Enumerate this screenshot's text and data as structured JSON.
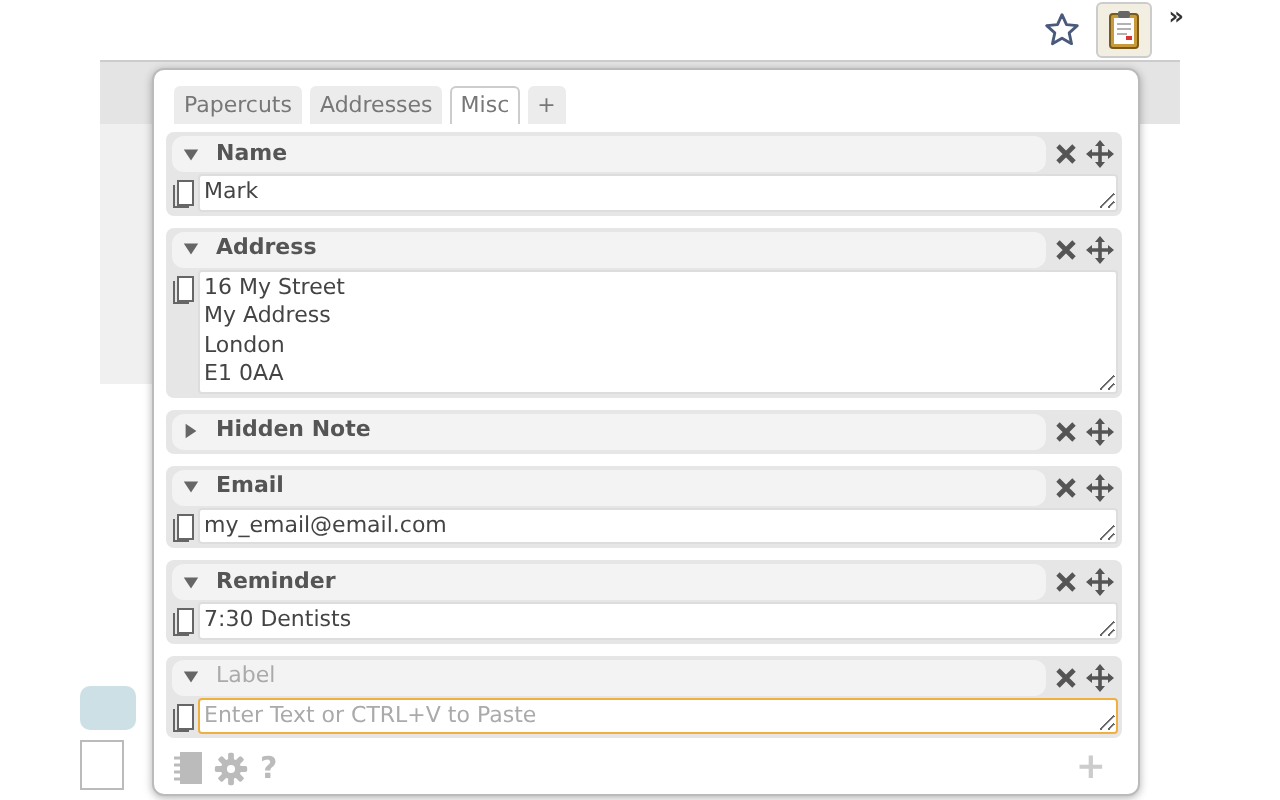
{
  "toolbar": {
    "overflow": "»"
  },
  "tabs": [
    {
      "label": "Papercuts",
      "selected": false
    },
    {
      "label": "Addresses",
      "selected": false
    },
    {
      "label": "Misc",
      "selected": true
    },
    {
      "label": "+",
      "selected": false
    }
  ],
  "entries": [
    {
      "title": "Name",
      "expanded": true,
      "value": "Mark",
      "focused": false
    },
    {
      "title": "Address",
      "expanded": true,
      "value": "16 My Street\nMy Address\nLondon\nE1 0AA",
      "focused": false
    },
    {
      "title": "Hidden Note",
      "expanded": false
    },
    {
      "title": "Email",
      "expanded": true,
      "value": "my_email@email.com",
      "focused": false
    },
    {
      "title": "Reminder",
      "expanded": true,
      "value": "7:30 Dentists",
      "focused": false
    },
    {
      "title_placeholder": "Label",
      "expanded": true,
      "placeholder": "Enter Text or CTRL+V to Paste",
      "focused": true
    }
  ],
  "footer": {
    "help": "?",
    "add": "+"
  }
}
